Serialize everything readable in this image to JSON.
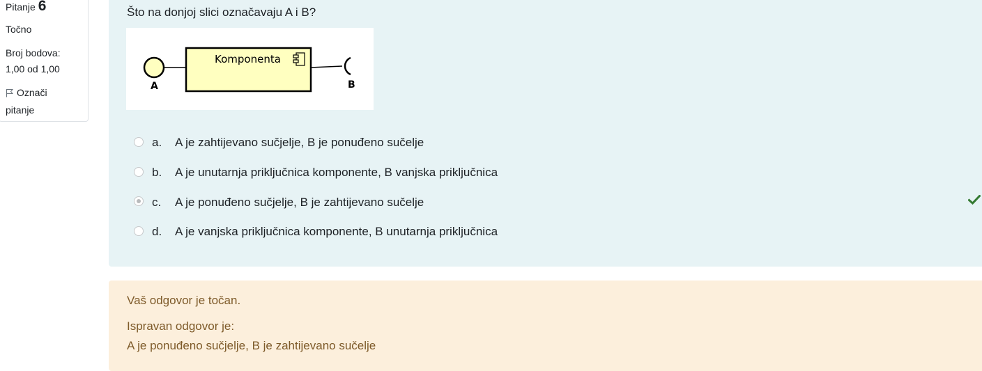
{
  "info": {
    "question_prefix": "Pitanje",
    "question_number": "6",
    "state": "Točno",
    "grade_line1": "Broj bodova:",
    "grade_line2": "1,00 od 1,00",
    "flag_line1": "Označi",
    "flag_line2": "pitanje"
  },
  "question": {
    "text": "Što na donjoj slici označavaju A i B?",
    "diagram": {
      "component_label": "Komponenta",
      "label_a": "A",
      "label_b": "B"
    },
    "answers": [
      {
        "letter": "a.",
        "text": "A je zahtijevano sučjelje, B je ponuđeno sučelje",
        "selected": false
      },
      {
        "letter": "b.",
        "text": "A je unutarnja priključnica komponente, B vanjska priključnica",
        "selected": false
      },
      {
        "letter": "c.",
        "text": "A je ponuđeno sučjelje, B je zahtijevano sučelje",
        "selected": true
      },
      {
        "letter": "d.",
        "text": "A je vanjska priključnica komponente, B unutarnja priključnica",
        "selected": false
      }
    ]
  },
  "feedback": {
    "result": "Vaš odgovor je točan.",
    "correct_label": "Ispravan odgovor je:",
    "correct_answer": "A je ponuđeno sučjelje, B je zahtijevano sučelje"
  },
  "colors": {
    "formulation_bg": "#e7f3f5",
    "feedback_bg": "#fcefdc",
    "feedback_text": "#7d5a29",
    "correct_check": "#357a32",
    "component_fill": "#ffffc0"
  }
}
